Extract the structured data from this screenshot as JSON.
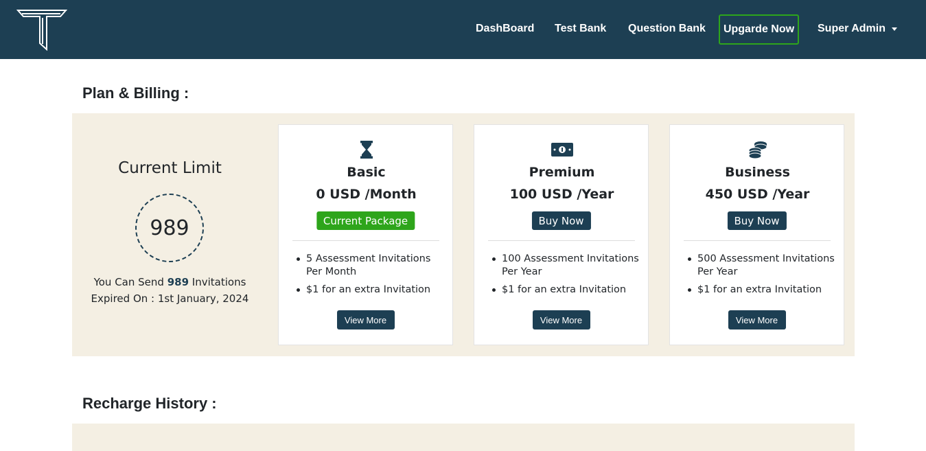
{
  "nav": {
    "links": [
      "DashBoard",
      "Test Bank",
      "Question Bank"
    ],
    "upgrade_label": "Upgarde Now",
    "user_label": "Super Admin"
  },
  "colors": {
    "navbar": "#1d3f53",
    "accent_green": "#2ea51b",
    "panel_bg": "#f4efe3"
  },
  "plan_billing": {
    "title": "Plan & Billing :",
    "current_limit": {
      "heading": "Current Limit",
      "count": "989",
      "send_prefix": "You Can Send",
      "send_count": "989",
      "send_suffix": "Invitations",
      "expiry": "Expired On : 1st January, 2024"
    },
    "plans": [
      {
        "icon": "hourglass-icon",
        "name": "Basic",
        "price": "0 USD /Month",
        "button": "Current Package",
        "features": [
          "5 Assessment Invitations Per Month",
          "$1 for an extra Invitation"
        ],
        "view_more": "View More"
      },
      {
        "icon": "money-bill-icon",
        "name": "Premium",
        "price": "100 USD /Year",
        "button": "Buy Now",
        "features": [
          "100 Assessment Invitations Per Year",
          "$1 for an extra Invitation"
        ],
        "view_more": "View More"
      },
      {
        "icon": "coins-icon",
        "name": "Business",
        "price": "450 USD /Year",
        "button": "Buy Now",
        "features": [
          "500 Assessment Invitations Per Year",
          "$1 for an extra Invitation"
        ],
        "view_more": "View More"
      }
    ]
  },
  "recharge_history": {
    "title": "Recharge History :"
  }
}
